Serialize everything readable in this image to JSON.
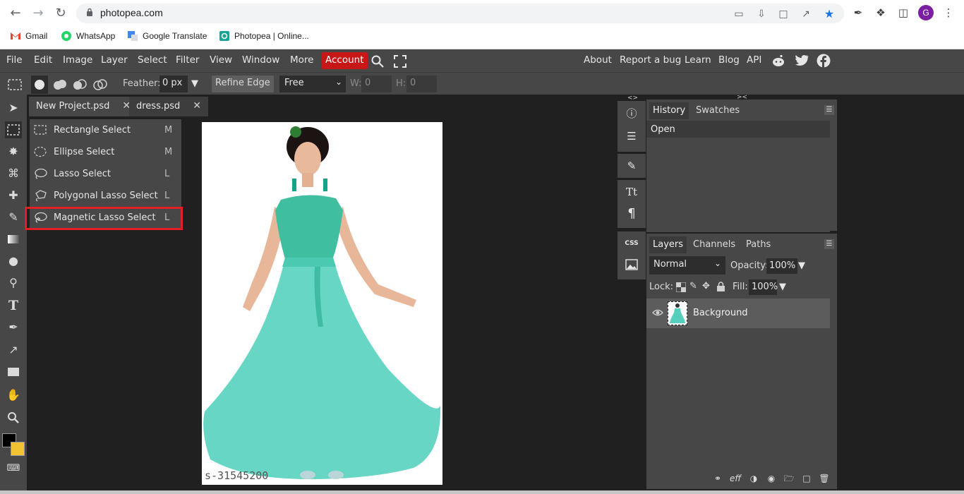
{
  "browser": {
    "url": "photopea.com",
    "profile_initial": "G",
    "bookmarks": [
      {
        "label": "Gmail"
      },
      {
        "label": "WhatsApp"
      },
      {
        "label": "Google Translate"
      },
      {
        "label": "Photopea | Online..."
      }
    ]
  },
  "menubar": {
    "items": [
      "File",
      "Edit",
      "Image",
      "Layer",
      "Select",
      "Filter",
      "View",
      "Window",
      "More"
    ],
    "account": "Account",
    "right_links": [
      "About",
      "Report a bug",
      "Learn",
      "Blog",
      "API"
    ]
  },
  "options": {
    "feather_label": "Feather:",
    "feather_value": "0 px",
    "refine_edge": "Refine Edge",
    "mode_value": "Free",
    "w_label": "W:",
    "w_value": "0",
    "h_label": "H:",
    "h_value": "0"
  },
  "tabs": [
    {
      "label": "New Project.psd",
      "close": "✕"
    },
    {
      "label": "dress.psd",
      "close": "✕"
    }
  ],
  "canvas": {
    "watermark": "s-31545200"
  },
  "select_menu": [
    {
      "label": "Rectangle Select",
      "key": "M",
      "icon": "rectangle-select-icon"
    },
    {
      "label": "Ellipse Select",
      "key": "M",
      "icon": "ellipse-select-icon"
    },
    {
      "label": "Lasso Select",
      "key": "L",
      "icon": "lasso-icon"
    },
    {
      "label": "Polygonal Lasso Select",
      "key": "L",
      "icon": "polygonal-lasso-icon"
    },
    {
      "label": "Magnetic Lasso Select",
      "key": "L",
      "icon": "magnetic-lasso-icon"
    }
  ],
  "history_panel": {
    "tabs": [
      "History",
      "Swatches"
    ],
    "rows": [
      "Open"
    ]
  },
  "layers_panel": {
    "tabs": [
      "Layers",
      "Channels",
      "Paths"
    ],
    "blend_mode": "Normal",
    "opacity_label": "Opacity:",
    "opacity_value": "100%",
    "lock_label": "Lock:",
    "fill_label": "Fill:",
    "fill_value": "100%",
    "layers": [
      {
        "name": "Background"
      }
    ]
  },
  "colors": {
    "accent_account": "#c81717",
    "highlight_box": "#e31e24",
    "foreground": "#000000",
    "background": "#f1c232"
  }
}
